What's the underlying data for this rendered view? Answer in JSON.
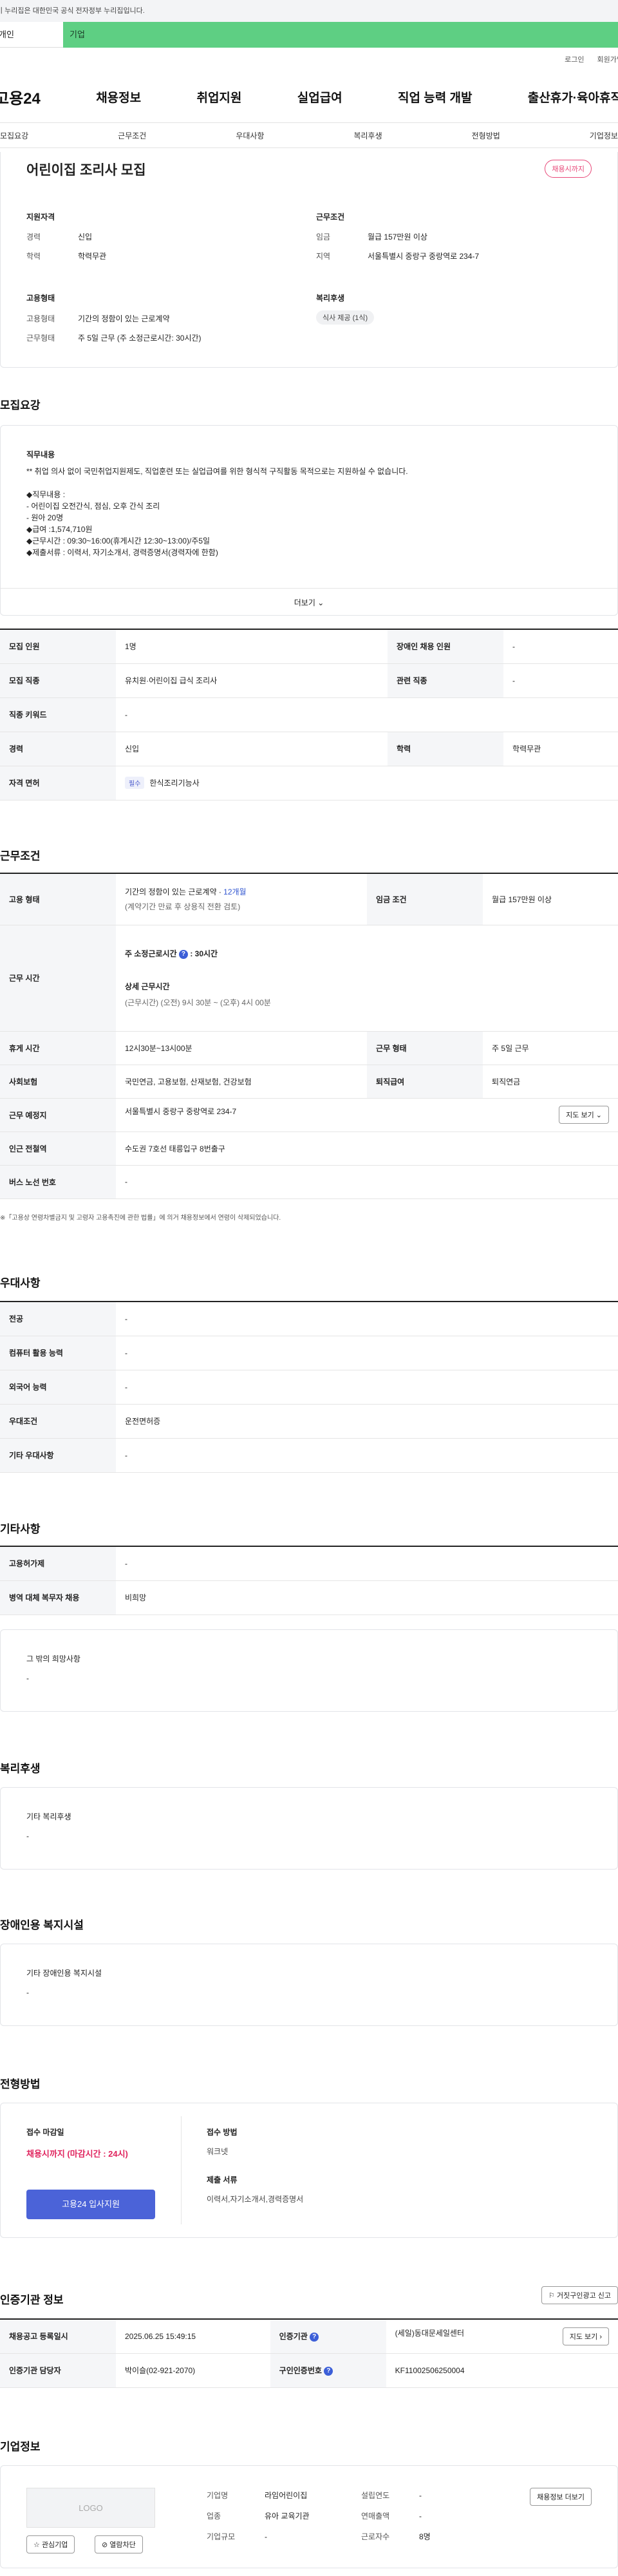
{
  "gov_banner": "이 누리집은 대한민국 공식 전자정부 누리집입니다.",
  "service_tabs": [
    "개인",
    "기업"
  ],
  "util": {
    "login": "로그인",
    "signup": "회원가입"
  },
  "gnb": {
    "logo": "고용24",
    "menu": [
      "채용정보",
      "취업지원",
      "실업급여",
      "직업 능력 개발",
      "출산휴가·육아휴직"
    ]
  },
  "tabs": [
    "모집요강",
    "근무조건",
    "우대사항",
    "복리후생",
    "전형방법",
    "기업정보"
  ],
  "summary": {
    "title": "어린이집 조리사 모집",
    "badge": "채용시까지",
    "qual_title": "지원자격",
    "qual": [
      {
        "k": "경력",
        "v": "신입"
      },
      {
        "k": "학력",
        "v": "학력무관"
      }
    ],
    "cond_title": "근무조건",
    "cond": [
      {
        "k": "임금",
        "v": "월급 157만원 이상"
      },
      {
        "k": "지역",
        "v": "서울특별시 중랑구 중랑역로 234-7"
      }
    ],
    "emp_title": "고용형태",
    "emp": [
      {
        "k": "고용형태",
        "v": "기간의 정함이 있는 근로계약"
      },
      {
        "k": "근무형태",
        "v": "주 5일 근무 (주 소정근로시간: 30시간)"
      }
    ],
    "welfare_title": "복리후생",
    "welfare_tag": "식사 제공 (1식)"
  },
  "recruit": {
    "title": "모집요강",
    "desc_title": "직무내용",
    "desc": [
      "** 취업 의사 없이 국민취업지원제도, 직업훈련 또는 실업급여를 위한 형식적 구직활동 목적으로는 지원하실 수 없습니다.",
      "",
      "◆직무내용 :",
      "- 어린이집 오전간식, 점심, 오후 간식 조리",
      "- 원아 20명",
      "◆급여 :1,574,710원",
      "◆근무시간 : 09:30~16:00(휴게시간 12:30~13:00)/주5일",
      "◆제출서류 : 이력서, 자기소개서, 경력증명서(경력자에 한함)"
    ],
    "more": "더보기",
    "rows": [
      {
        "k1": "모집 인원",
        "v1": "1명",
        "k2": "장애인 채용 인원",
        "v2": "-"
      },
      {
        "k1": "모집 직종",
        "v1": "유치원·어린이집 급식 조리사",
        "k2": "관련 직종",
        "v2": "-"
      },
      {
        "k1": "직종 키워드",
        "v1": "-"
      },
      {
        "k1": "경력",
        "v1": "신입",
        "k2": "학력",
        "v2": "학력무관"
      },
      {
        "k1": "자격 면허",
        "tag": "필수",
        "v1": "한식조리기능사"
      }
    ]
  },
  "work": {
    "title": "근무조건",
    "emp_k": "고용 형태",
    "emp_v1": "기간의 정함이 있는 근로계약 · ",
    "emp_v1b": "12개월",
    "emp_v2": "(계약기간 만료 후 상용직 전환 검토)",
    "wage_k": "임금 조건",
    "wage_v": "월급 157만원 이상",
    "time_k": "근무 시간",
    "time_a": "주 소정근로시간",
    "time_a2": ": 30시간",
    "time_b": "상세 근무시간",
    "time_c": "(근무시간) (오전) 9시 30분 ~ (오후) 4시 00분",
    "rows": [
      {
        "k1": "휴게 시간",
        "v1": "12시30분~13시00분",
        "k2": "근무 형태",
        "v2": "주 5일 근무"
      },
      {
        "k1": "사회보험",
        "v1": "국민연금, 고용보험, 산재보험, 건강보험",
        "k2": "퇴직급여",
        "v2": "퇴직연금"
      },
      {
        "k1": "근무 예정지",
        "v1": "서울특별시 중랑구 중랑역로 234-7",
        "btn": "지도 보기"
      },
      {
        "k1": "인근 전철역",
        "v1": "수도권 7호선 태릉입구 8번출구"
      },
      {
        "k1": "버스 노선 번호",
        "v1": "-"
      }
    ],
    "note": "※「고용상 연령차별금지 및 고령자 고용촉진에 관한 법률」에 의거 채용정보에서 연령이 삭제되었습니다."
  },
  "pref": {
    "title": "우대사항",
    "rows": [
      {
        "k": "전공",
        "v": "-"
      },
      {
        "k": "컴퓨터 활용 능력",
        "v": "-"
      },
      {
        "k": "외국어 능력",
        "v": "-"
      },
      {
        "k": "우대조건",
        "v": "운전면허증"
      },
      {
        "k": "기타 우대사항",
        "v": "-"
      }
    ]
  },
  "etc": {
    "title": "기타사항",
    "rows": [
      {
        "k": "고용허가제",
        "v": "-"
      },
      {
        "k": "병역 대체 복무자 채용",
        "v": "비희망"
      }
    ],
    "box_title": "그 밖의 희망사항",
    "box_v": "-"
  },
  "welfare": {
    "title": "복리후생",
    "box_title": "기타 복리후생",
    "box_v": "-"
  },
  "disab": {
    "title": "장애인용 복지시설",
    "box_title": "기타 장애인용 복지시설",
    "box_v": "-"
  },
  "process": {
    "title": "전형방법",
    "deadline_k": "접수 마감일",
    "deadline_v": "채용시까지 (마감시간 : 24시)",
    "apply_btn": "고용24 입사지원",
    "method_k": "접수 방법",
    "method_v": "워크넷",
    "docs_k": "제출 서류",
    "docs_v": "이력서,자기소개서,경력증명서"
  },
  "agency": {
    "title": "인증기관 정보",
    "report_btn": "거짓구인광고 신고",
    "rows": [
      {
        "k1": "채용공고 등록일시",
        "v1": "2025.06.25 15:49:15",
        "k2": "인증기관",
        "v2": "(세일)동대문세일센터",
        "btn": "지도 보기"
      },
      {
        "k1": "인증기관 담당자",
        "v1": "박이슬(02-921-2070)",
        "k2": "구인인증번호",
        "v2": "KF11002506250004"
      }
    ]
  },
  "company": {
    "title": "기업정보",
    "logo": "LOGO",
    "btn_fav": "관심기업",
    "btn_block": "열람차단",
    "btn_other": "채용정보 더보기",
    "info": [
      {
        "k": "기업명",
        "v": "라임어린이집",
        "k2": "설립연도",
        "v2": "-"
      },
      {
        "k": "업종",
        "v": "유아 교육기관",
        "k2": "연매출액",
        "v2": "-"
      },
      {
        "k": "기업규모",
        "v": "-",
        "k2": "근로자수",
        "v2": "8명"
      }
    ]
  }
}
